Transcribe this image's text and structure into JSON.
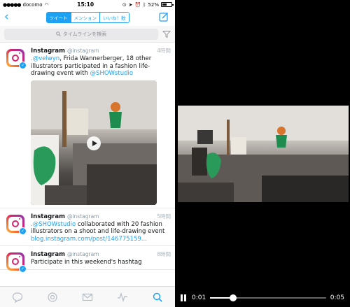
{
  "statusbar": {
    "carrier": "docomo",
    "time": "15:10",
    "battery": "52%",
    "battery_level": 0.52
  },
  "nav": {
    "tabs": [
      {
        "label": "ツイート",
        "active": true
      },
      {
        "label": "メンション",
        "active": false
      },
      {
        "label": "いいね！数",
        "active": false
      }
    ]
  },
  "search": {
    "placeholder": "タイムラインを検索"
  },
  "tweets": [
    {
      "name": "Instagram",
      "handle": "@instagram",
      "time": "4時間",
      "text_link1": ".@velwyn",
      "text_body": ", Frida Wannerberger, 18 other illustrators participated in a fashion life-drawing event with ",
      "text_link2": "@SHOWstudio"
    },
    {
      "name": "Instagram",
      "handle": "@instagram",
      "time": "5時間",
      "text_link1": ".@SHOWstudio",
      "text_body": " collaborated with 20 fashion illustrators on a shoot and life-drawing event ",
      "text_link2": "blog.instagram.com/post/146775159..."
    },
    {
      "name": "Instagram",
      "handle": "@instagram",
      "time": "8時間",
      "text_body": "Participate in this weekend's hashtag"
    }
  ],
  "player": {
    "current": "0:01",
    "duration": "0:05",
    "progress": 0.2
  },
  "colors": {
    "accent": "#1da1f2"
  },
  "icons": {
    "back": "chevron-left-icon",
    "compose": "compose-icon",
    "search": "search-icon",
    "filter": "filter-icon",
    "play": "play-icon",
    "pause": "pause-icon",
    "verified": "verified-icon"
  }
}
